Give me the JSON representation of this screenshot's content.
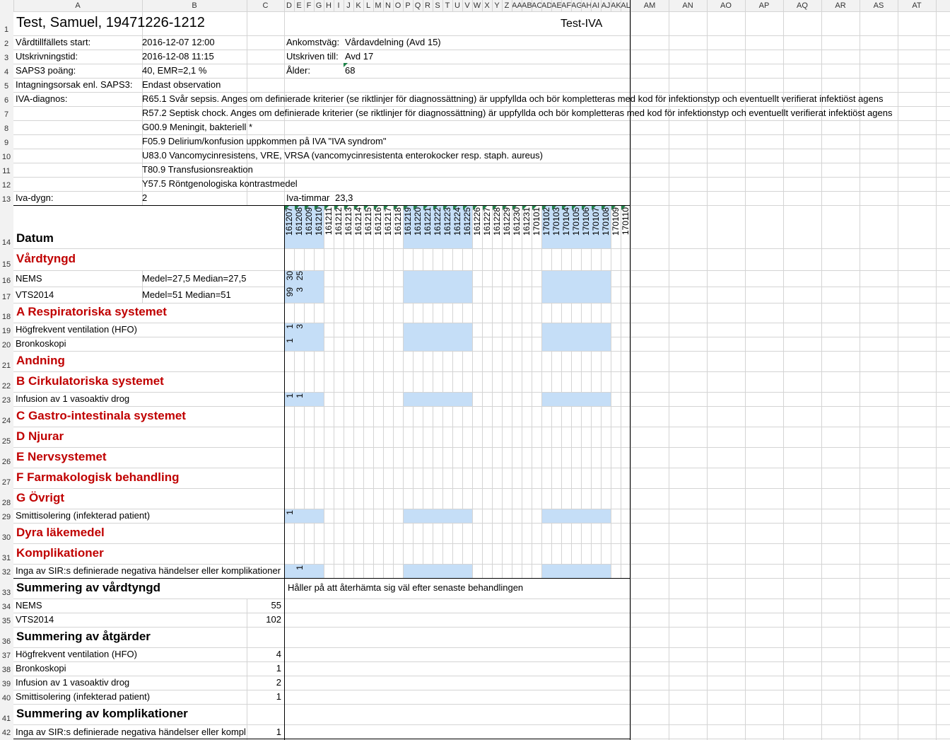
{
  "columns": [
    "A",
    "B",
    "C",
    "D",
    "E",
    "F",
    "G",
    "H",
    "I",
    "J",
    "K",
    "L",
    "M",
    "N",
    "O",
    "P",
    "Q",
    "R",
    "S",
    "T",
    "U",
    "V",
    "W",
    "X",
    "Y",
    "Z",
    "AA",
    "AB",
    "AC",
    "AD",
    "AE",
    "AF",
    "AG",
    "AH",
    "AI",
    "AJ",
    "AK",
    "AL",
    "AM",
    "AN",
    "AO",
    "AP",
    "AQ",
    "AR",
    "AS",
    "AT"
  ],
  "header": {
    "patient": "Test, Samuel, 19471226-1212",
    "unit": "Test-IVA"
  },
  "info": [
    {
      "label": "Vårdtillfällets start:",
      "value": "2016-12-07 12:00",
      "label2": "Ankomstväg:",
      "value2": "Vårdavdelning (Avd 15)"
    },
    {
      "label": "Utskrivningstid:",
      "value": "2016-12-08 11:15",
      "label2": "Utskriven till:",
      "value2": "Avd 17"
    },
    {
      "label": "SAPS3 poäng:",
      "value": "40,  EMR=2,1 %",
      "label2": "Ålder:",
      "value2": "68"
    },
    {
      "label": "Intagningsorsak enl. SAPS3:",
      "value": "Endast observation"
    }
  ],
  "diagnoses_label": "IVA-diagnos:",
  "diagnoses": [
    "R65.1 Svår sepsis. Anges om definierade kriterier (se riktlinjer för diagnossättning) är uppfyllda och bör kompletteras med kod för infektionstyp och eventuellt verifierat infektiöst agens",
    "R57.2 Septisk chock. Anges om definierade kriterier (se riktlinjer för diagnossättning) är uppfyllda och bör kompletteras med kod för infektionstyp och eventuellt verifierat infektiöst agens",
    "G00.9 Meningit, bakteriell *",
    "F05.9 Delirium/konfusion uppkommen på IVA \"IVA syndrom\"",
    "U83.0 Vancomycinresistens, VRE, VRSA (vancomycinresistenta enterokocker resp. staph. aureus)",
    "T80.9 Transfusionsreaktion",
    "Y57.5 Röntgenologiska kontrastmedel"
  ],
  "iva_dygn_label": "Iva-dygn:",
  "iva_dygn": "2",
  "iva_timmar_label": "Iva-timmar",
  "iva_timmar": "23,3",
  "datum_label": "Datum",
  "dates": [
    "161207",
    "161208",
    "161209",
    "161210",
    "161211",
    "161212",
    "161213",
    "161214",
    "161215",
    "161216",
    "161217",
    "161218",
    "161219",
    "161220",
    "161221",
    "161222",
    "161223",
    "161224",
    "161225",
    "161226",
    "161227",
    "161228",
    "161229",
    "161230",
    "161231",
    "170101",
    "170102",
    "170103",
    "170104",
    "170105",
    "170106",
    "170107",
    "170108",
    "170109",
    "170110"
  ],
  "sections": {
    "vardtyngd": "Vårdtyngd",
    "resp": "A Respiratoriska systemet",
    "andning": "Andning",
    "cirk": "B Cirkulatoriska systemet",
    "gastro": "C Gastro-intestinala systemet",
    "njurar": "D Njurar",
    "nerv": "E Nervsystemet",
    "farm": "F Farmakologisk behandling",
    "ovrigt": "G Övrigt",
    "dyra": "Dyra läkemedel",
    "kompl": "Komplikationer"
  },
  "rows": {
    "nems": {
      "label": "NEMS",
      "stats": "Medel=27,5   Median=27,5",
      "values": [
        "30",
        "25"
      ]
    },
    "vts": {
      "label": "VTS2014",
      "stats": "Medel=51   Median=51",
      "values": [
        "99",
        "3"
      ]
    },
    "hfo": {
      "label": "Högfrekvent ventilation (HFO)",
      "values": [
        "1",
        "3"
      ]
    },
    "bronk": {
      "label": "Bronkoskopi",
      "values": [
        "1"
      ]
    },
    "infusion": {
      "label": "Infusion av 1 vasoaktiv drog",
      "values": [
        "1",
        "1"
      ]
    },
    "smitt": {
      "label": "Smittisolering (infekterad patient)",
      "values": [
        "1"
      ]
    },
    "inga": {
      "label": "Inga av SIR:s definierade negativa händelser eller komplikationer",
      "values": [
        "",
        "1"
      ]
    }
  },
  "summary": {
    "vardtyngd_title": "Summering av vårdtyngd",
    "nems_label": "NEMS",
    "nems_value": "55",
    "vts_label": "VTS2014",
    "vts_value": "102",
    "atgarder_title": "Summering av åtgärder",
    "hfo_label": "Högfrekvent ventilation (HFO)",
    "hfo_value": "4",
    "bronk_label": "Bronkoskopi",
    "bronk_value": "1",
    "inf_label": "Infusion av 1 vasoaktiv drog",
    "inf_value": "2",
    "smitt_label": "Smittisolering (infekterad patient)",
    "smitt_value": "1",
    "kompl_title": "Summering av komplikationer",
    "inga_label": "Inga av SIR:s definierade negativa händelser eller komplikationer",
    "inga_value": "1",
    "note": "Håller på att återhämta sig väl efter senaste behandlingen"
  }
}
